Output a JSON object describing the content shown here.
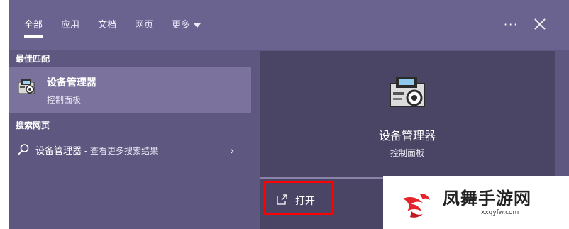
{
  "tabs": [
    {
      "label": "全部",
      "active": true
    },
    {
      "label": "应用",
      "active": false
    },
    {
      "label": "文档",
      "active": false
    },
    {
      "label": "网页",
      "active": false
    },
    {
      "label": "更多",
      "active": false
    }
  ],
  "toolbar": {
    "more_icon": "ellipsis-icon",
    "close_icon": "close-icon"
  },
  "left": {
    "best_match_label": "最佳匹配",
    "best_match": {
      "title": "设备管理器",
      "subtitle": "控制面板",
      "icon": "device-manager-icon"
    },
    "web_label": "搜索网页",
    "web_result": {
      "query": "设备管理器",
      "suffix": " - 查看更多搜索结果",
      "icon": "search-icon"
    }
  },
  "preview": {
    "title": "设备管理器",
    "subtitle": "控制面板",
    "icon": "device-manager-icon",
    "action_label": "打开",
    "action_icon": "open-window-icon"
  },
  "watermark": {
    "name": "凤舞手游网",
    "url": "xxqyfw.com"
  },
  "colors": {
    "panel": "#5e577f",
    "preview": "#4a4565",
    "selected": "#7b739e",
    "highlight": "#ff0000"
  }
}
